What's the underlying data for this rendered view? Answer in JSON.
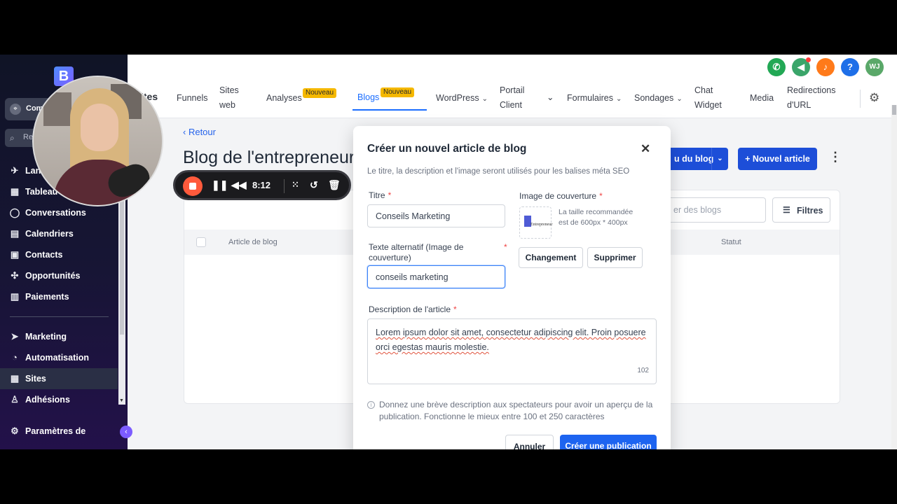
{
  "sidebar": {
    "logo_letter": "B",
    "account_label": "Com",
    "search_placeholder": "Rec",
    "nav_items": [
      {
        "label": "Lan",
        "icon": "rocket-icon"
      },
      {
        "label": "Tableau d",
        "icon": "grid-icon"
      },
      {
        "label": "Conversations",
        "icon": "chat-icon"
      },
      {
        "label": "Calendriers",
        "icon": "calendar-icon"
      },
      {
        "label": "Contacts",
        "icon": "contacts-icon"
      },
      {
        "label": "Opportunités",
        "icon": "network-icon"
      },
      {
        "label": "Paiements",
        "icon": "receipt-icon"
      }
    ],
    "nav_items_2": [
      {
        "label": "Marketing",
        "icon": "send-icon"
      },
      {
        "label": "Automatisation",
        "icon": "automation-icon"
      },
      {
        "label": "Sites",
        "icon": "sites-icon"
      },
      {
        "label": "Adhésions",
        "icon": "award-icon"
      }
    ],
    "settings_label": "Paramètres de",
    "active": "Sites"
  },
  "topbar": {
    "cut_label": "ites",
    "user_initials": "WJ",
    "nav": {
      "funnels": "Funnels",
      "sites_web_1": "Sites",
      "sites_web_2": "web",
      "analyses": "Analyses",
      "blogs": "Blogs",
      "badge_new": "Nouveau",
      "wordpress": "WordPress",
      "portail_1": "Portail",
      "portail_2": "Client",
      "formulaires": "Formulaires",
      "sondages": "Sondages",
      "chat_1": "Chat",
      "chat_2": "Widget",
      "media": "Media",
      "redirections_1": "Redirections",
      "redirections_2": "d'URL"
    }
  },
  "page": {
    "back_label": "Retour",
    "title": "Blog de l'entrepreneur",
    "blog_settings_label": "u du blog",
    "new_article_label": "+ Nouvel article",
    "search_placeholder": "er des blogs",
    "filters_label": "Filtres",
    "table_headers": [
      "Article de blog",
      "Statut"
    ]
  },
  "modal": {
    "title": "Créer un nouvel article de blog",
    "subtitle": "Le titre, la description et l'image seront utilisés pour les balises méta SEO",
    "title_label": "Titre",
    "title_value": "Conseils Marketing",
    "alt_label": "Texte alternatif (Image de couverture)",
    "alt_value": "conseils marketing",
    "cover_label": "Image de couverture",
    "cover_hint": "La taille recommandée est de 600px * 400px",
    "cover_thumb_text": "Entrepreneur",
    "change_label": "Changement",
    "delete_label": "Supprimer",
    "description_label": "Description de l'article",
    "description_value": "Lorem ipsum dolor sit amet, consectetur adipiscing elit. Proin posuere orci egestas mauris molestie.",
    "char_count": "102",
    "help_text": "Donnez une brève description aux spectateurs pour avoir un aperçu de la publication. Fonctionne le mieux entre 100 et 250 caractères",
    "cancel_label": "Annuler",
    "create_label": "Créer une publication"
  },
  "recorder": {
    "time": "8:12"
  },
  "colors": {
    "accent": "#1d4ed8",
    "badge": "#f5b800",
    "record": "#ff5a3c",
    "phone": "#22a855",
    "bell": "#ff7a1a",
    "help": "#1e6fe8",
    "avatar": "#5aa869"
  }
}
